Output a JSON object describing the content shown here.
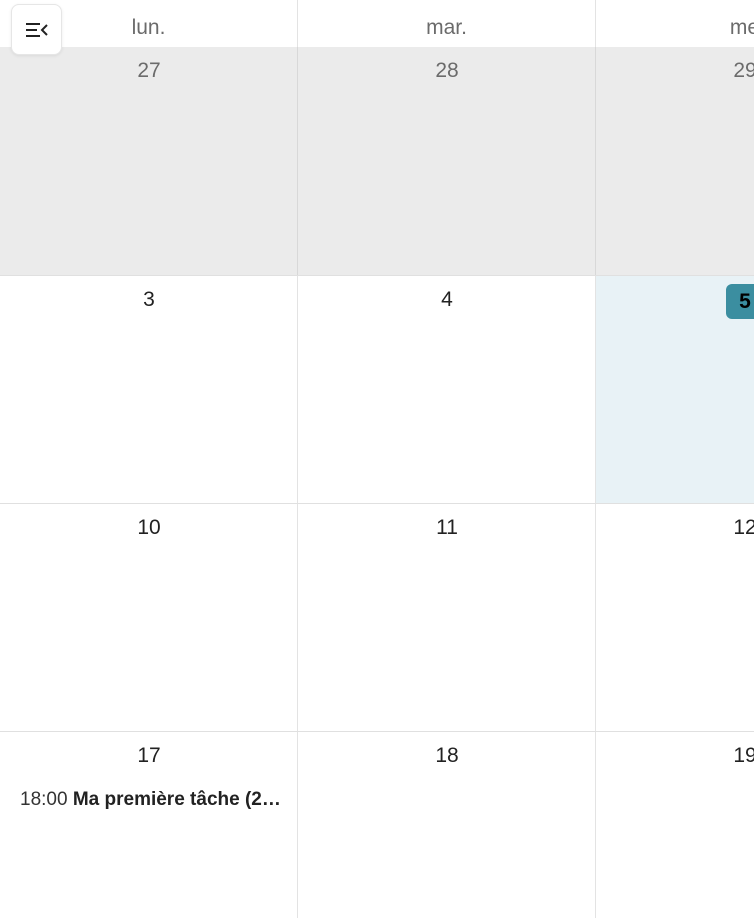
{
  "toolbar": {
    "menu_icon": "menu-collapse-icon"
  },
  "weekday_headers": [
    "lun.",
    "mar.",
    "me"
  ],
  "weeks": [
    {
      "days": [
        "27",
        "28",
        "29"
      ]
    },
    {
      "days": [
        "3",
        "4",
        "5"
      ]
    },
    {
      "days": [
        "10",
        "11",
        "12"
      ]
    },
    {
      "days": [
        "17",
        "18",
        "19"
      ]
    }
  ],
  "today_date": "5",
  "events": [
    {
      "day": "17",
      "time": "18:00",
      "title": "Ma première tâche (2…"
    }
  ],
  "colors": {
    "today_badge": "#3b8ea0",
    "today_cell": "#e8f2f6",
    "past_cell": "#ebebeb"
  }
}
